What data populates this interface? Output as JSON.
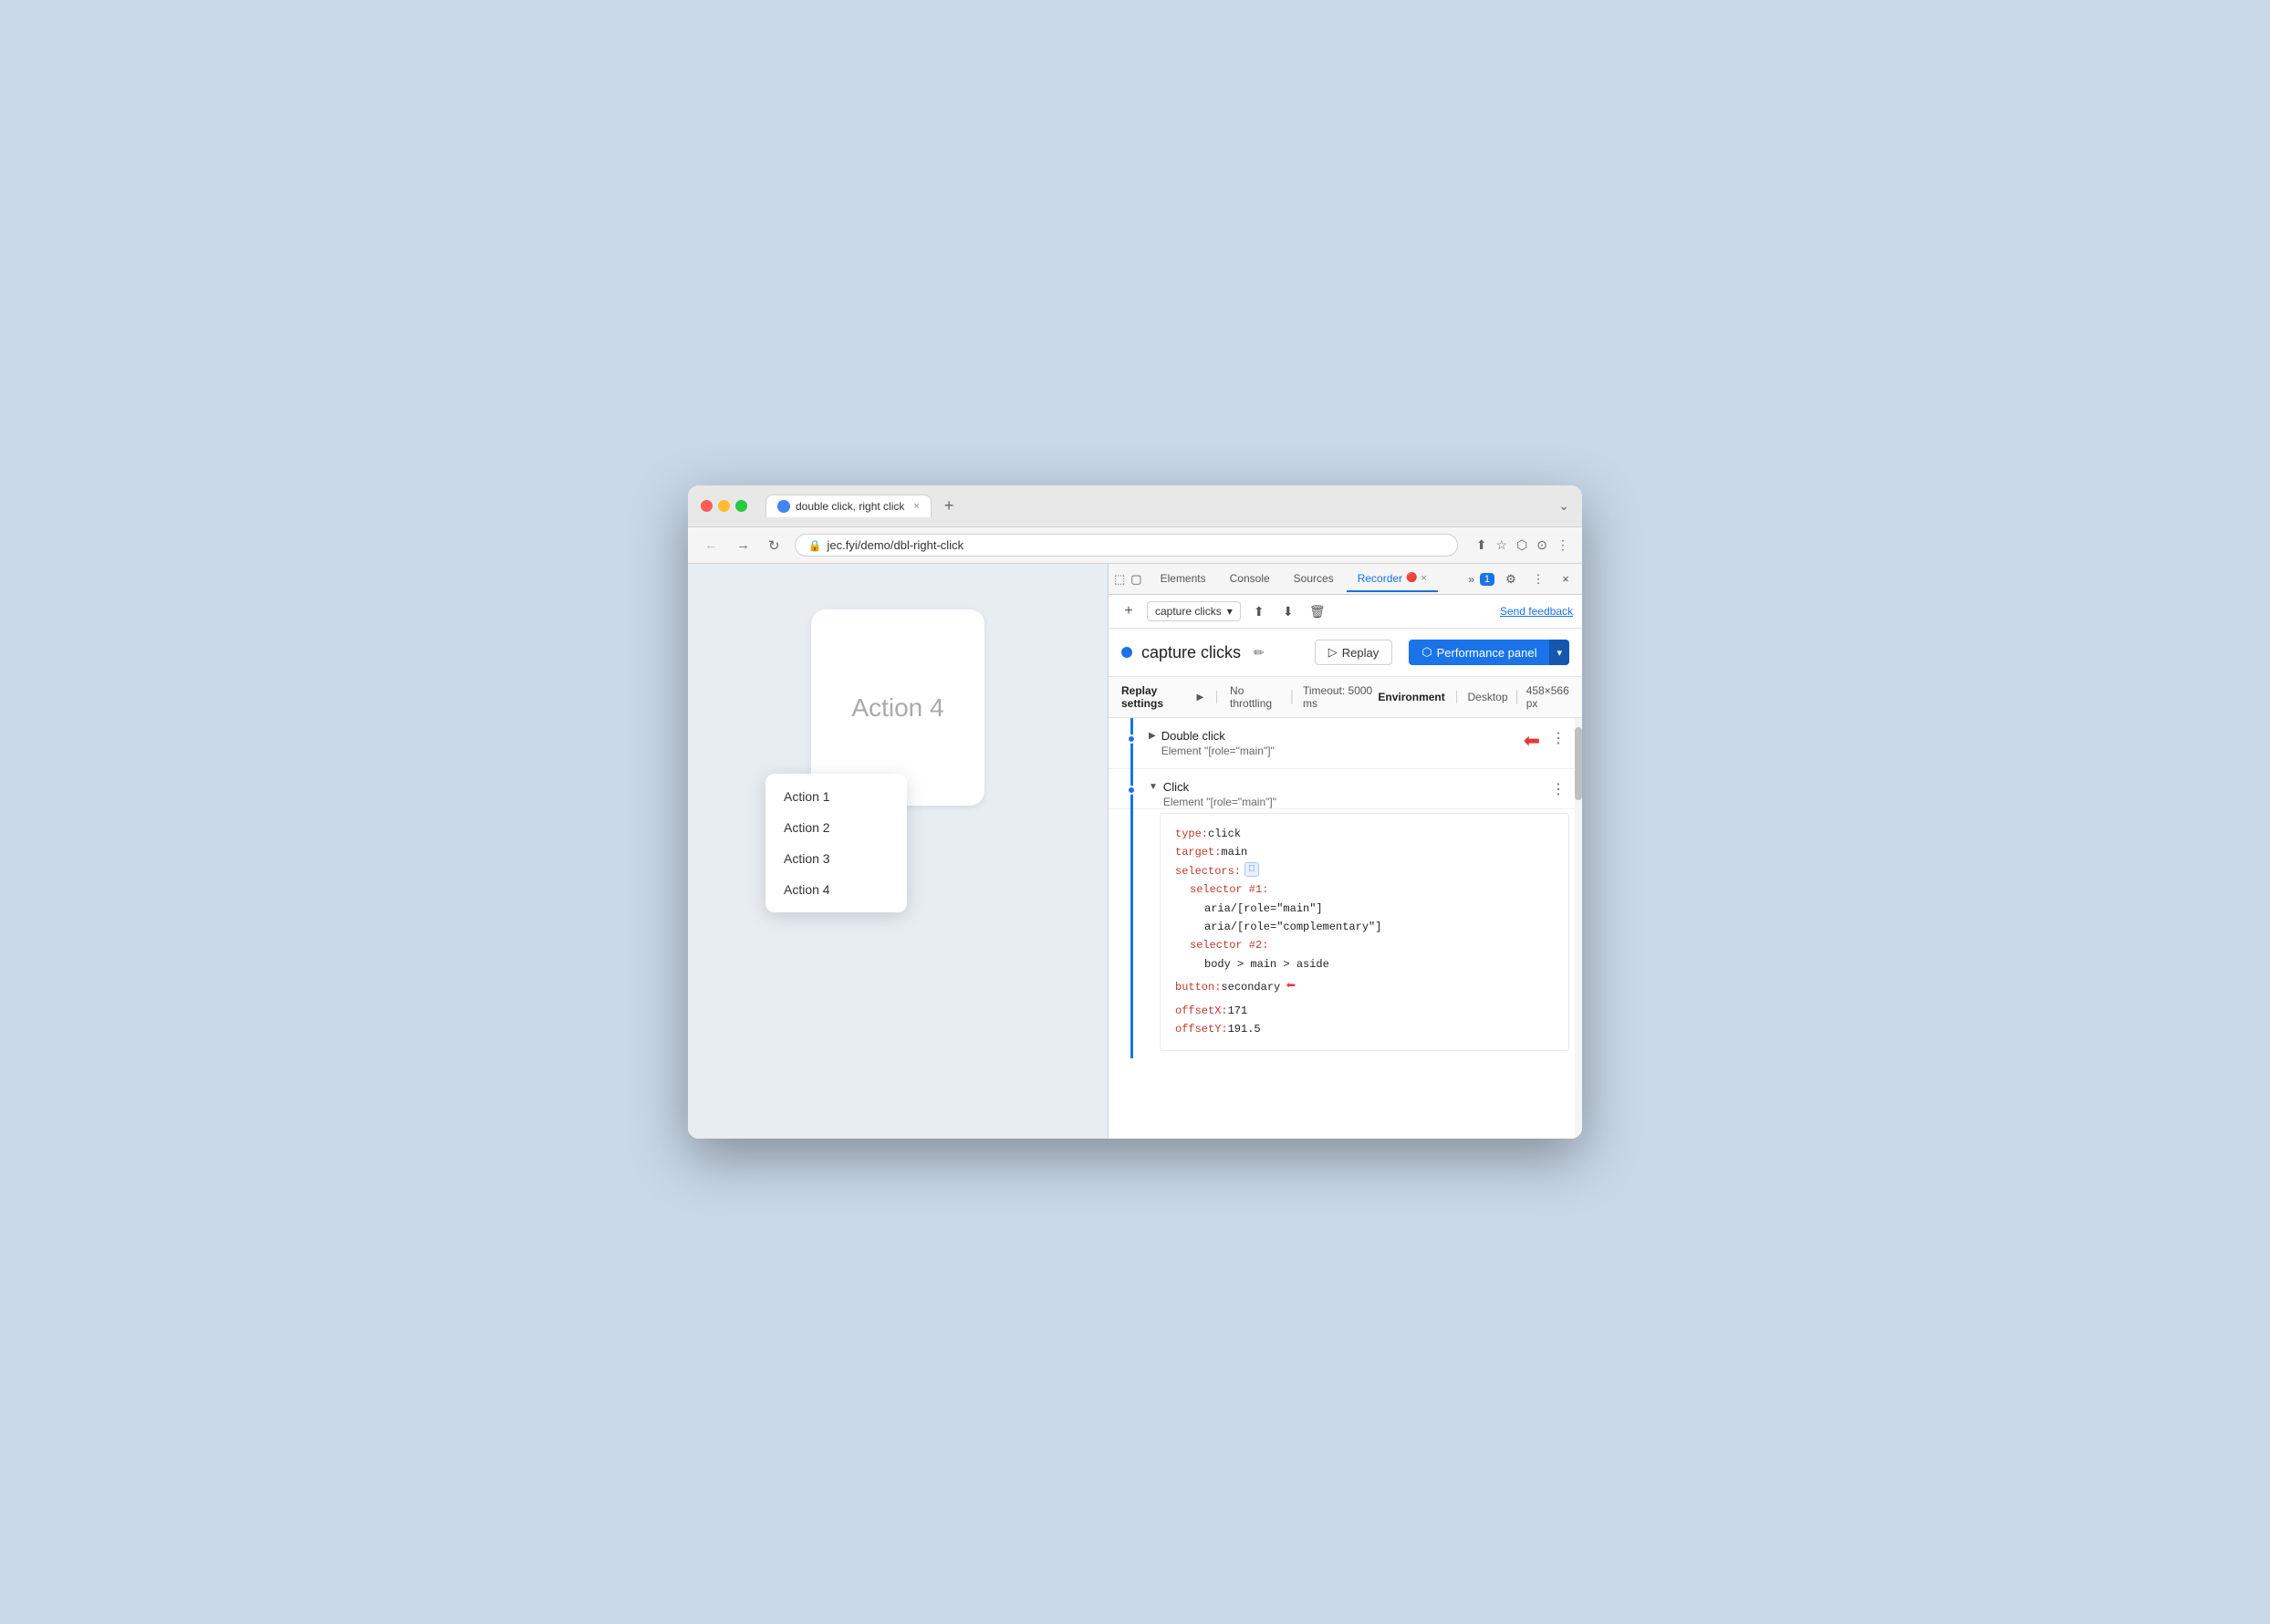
{
  "window": {
    "title": "double click, right click"
  },
  "browser": {
    "back_btn": "←",
    "forward_btn": "→",
    "reload_btn": "↻",
    "address": "jec.fyi/demo/dbl-right-click",
    "share_icon": "⬆",
    "bookmark_icon": "☆",
    "extension_icon": "⬡",
    "account_icon": "👤",
    "more_icon": "⋮",
    "new_tab_icon": "+",
    "chevron_down": "⌄"
  },
  "webpage": {
    "main_card_text": "Action 4",
    "context_menu_items": [
      "Action 1",
      "Action 2",
      "Action 3",
      "Action 4"
    ]
  },
  "devtools": {
    "tabs": [
      {
        "label": "Elements",
        "active": false
      },
      {
        "label": "Console",
        "active": false
      },
      {
        "label": "Sources",
        "active": false
      },
      {
        "label": "Recorder",
        "active": true
      }
    ],
    "more_tabs_icon": "»",
    "notification_badge": "1",
    "settings_icon": "⚙",
    "more_icon": "⋮",
    "close_icon": "×",
    "panel_select_icon": "▢",
    "device_icon": "📱",
    "recorder_name_icon": "🔴"
  },
  "recorder": {
    "add_icon": "+",
    "recording_name": "capture clicks",
    "dropdown_icon": "▾",
    "export_icon": "⬆",
    "import_icon": "⬇",
    "delete_icon": "🗑",
    "send_feedback_label": "Send feedback",
    "status_dot_color": "#1a73e8",
    "edit_icon": "✏",
    "replay_label": "Replay",
    "replay_play_icon": "▷",
    "performance_panel_label": "Performance panel",
    "performance_icon": "⬡",
    "performance_dropdown_icon": "▾",
    "settings": {
      "label": "Replay settings",
      "arrow": "▶",
      "throttling": "No throttling",
      "timeout_label": "Timeout: 5000 ms",
      "environment_label": "Environment",
      "desktop_label": "Desktop",
      "resolution": "458×566 px"
    },
    "actions": [
      {
        "id": 1,
        "type": "Double click",
        "element": "Element \"[role=\"main\"]\"",
        "expanded": false,
        "has_arrow": true
      },
      {
        "id": 2,
        "type": "Click",
        "element": "Element \"[role=\"main\"]\"",
        "expanded": true,
        "has_arrow": false,
        "code": {
          "lines": [
            {
              "key": "type: ",
              "val": "click"
            },
            {
              "key": "target: ",
              "val": "main"
            },
            {
              "key": "selectors: ",
              "val": "",
              "has_selector_icon": true
            },
            {
              "key": "  selector #1:",
              "val": ""
            },
            {
              "key": "    ",
              "val": "aria/[role=\"main\"]",
              "indent": 2
            },
            {
              "key": "    ",
              "val": "aria/[role=\"complementary\"]",
              "indent": 2
            },
            {
              "key": "  selector #2:",
              "val": ""
            },
            {
              "key": "    ",
              "val": "body > main > aside",
              "indent": 2
            },
            {
              "key": "button: ",
              "val": "secondary",
              "has_arrow": true
            },
            {
              "key": "offsetX: ",
              "val": "171"
            },
            {
              "key": "offsetY: ",
              "val": "191.5"
            }
          ]
        }
      }
    ]
  }
}
